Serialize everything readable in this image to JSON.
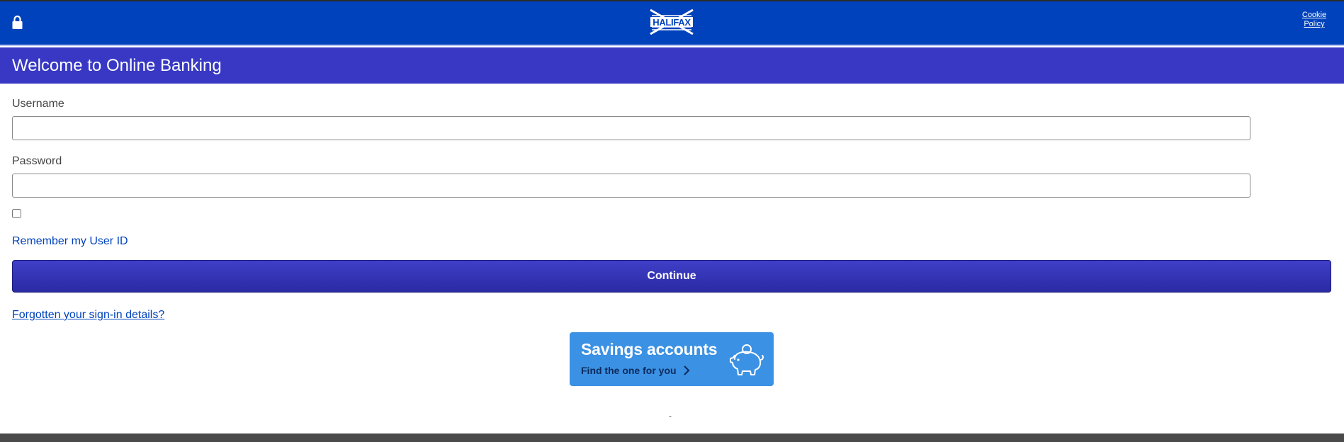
{
  "header": {
    "logo_text": "HALIFAX",
    "cookie_line1": "Cookie",
    "cookie_line2": "Policy",
    "icons": {
      "lock": "lock-icon",
      "logo": "halifax-x-logo"
    }
  },
  "page": {
    "title": "Welcome to Online Banking"
  },
  "form": {
    "username_label": "Username",
    "username_value": "",
    "password_label": "Password",
    "password_value": "",
    "remember_checked": false,
    "remember_label": "Remember my User ID",
    "continue_label": "Continue",
    "forgot_link": "Forgotten your sign-in details?"
  },
  "promo": {
    "title": "Savings accounts",
    "subtitle": "Find the one for you",
    "icons": {
      "chevron": "chevron-right-icon",
      "piggy": "piggy-bank-icon"
    }
  },
  "misc": {
    "dash": "-"
  },
  "colors": {
    "header_bg": "#0042bb",
    "titlebar_bg": "#3838c4",
    "button_bg": "#3232b8",
    "promo_bg": "#3b91e3",
    "link": "#0042bb",
    "footer_bg": "#4a4a4a"
  }
}
